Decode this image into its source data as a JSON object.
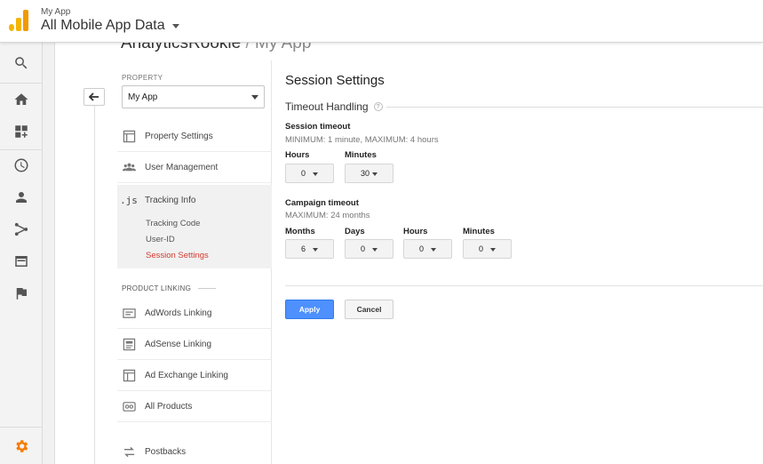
{
  "header": {
    "account_name": "My App",
    "view_name": "All Mobile App Data"
  },
  "rail": {
    "items": [
      {
        "icon": "search-icon"
      },
      {
        "icon": "home-icon"
      },
      {
        "icon": "customization-icon"
      },
      {
        "icon": "realtime-clock-icon"
      },
      {
        "icon": "audience-person-icon"
      },
      {
        "icon": "acquisition-icon"
      },
      {
        "icon": "behavior-icon"
      },
      {
        "icon": "conversions-flag-icon"
      },
      {
        "icon": "admin-gear-icon"
      }
    ],
    "admin_color": "#f57c00"
  },
  "breadcrumb": {
    "root": "AnalyticsRookie",
    "separator": "/",
    "current": "My App"
  },
  "property_nav": {
    "label": "PROPERTY",
    "selected_property": "My App",
    "items": [
      {
        "label": "Property Settings",
        "icon": "property-settings-icon"
      },
      {
        "label": "User Management",
        "icon": "users-icon"
      },
      {
        "label": "Tracking Info",
        "icon": "js-icon",
        "glyph": ".js"
      }
    ],
    "tracking_sub_items": [
      {
        "label": "Tracking Code"
      },
      {
        "label": "User-ID"
      },
      {
        "label": "Session Settings",
        "active": true
      }
    ],
    "product_linking_label": "PRODUCT LINKING",
    "linking_items": [
      {
        "label": "AdWords Linking",
        "icon": "adwords-icon"
      },
      {
        "label": "AdSense Linking",
        "icon": "adsense-icon"
      },
      {
        "label": "Ad Exchange Linking",
        "icon": "ad-exchange-icon"
      },
      {
        "label": "All Products",
        "icon": "all-products-icon"
      },
      {
        "label": "Postbacks",
        "icon": "postbacks-icon"
      }
    ]
  },
  "content": {
    "title": "Session Settings",
    "section_title": "Timeout Handling",
    "help_glyph": "?",
    "session_timeout": {
      "title": "Session timeout",
      "hint": "MINIMUM: 1 minute, MAXIMUM: 4 hours",
      "hours_label": "Hours",
      "hours_value": "0",
      "minutes_label": "Minutes",
      "minutes_value": "30"
    },
    "campaign_timeout": {
      "title": "Campaign timeout",
      "hint": "MAXIMUM: 24 months",
      "months_label": "Months",
      "months_value": "6",
      "days_label": "Days",
      "days_value": "0",
      "hours_label": "Hours",
      "hours_value": "0",
      "minutes_label": "Minutes",
      "minutes_value": "0"
    },
    "apply_label": "Apply",
    "cancel_label": "Cancel"
  },
  "colors": {
    "accent_blue": "#4d90fe",
    "active_red": "#d23a2f",
    "logo_yellow": "#f4b400",
    "logo_orange": "#f29900"
  }
}
